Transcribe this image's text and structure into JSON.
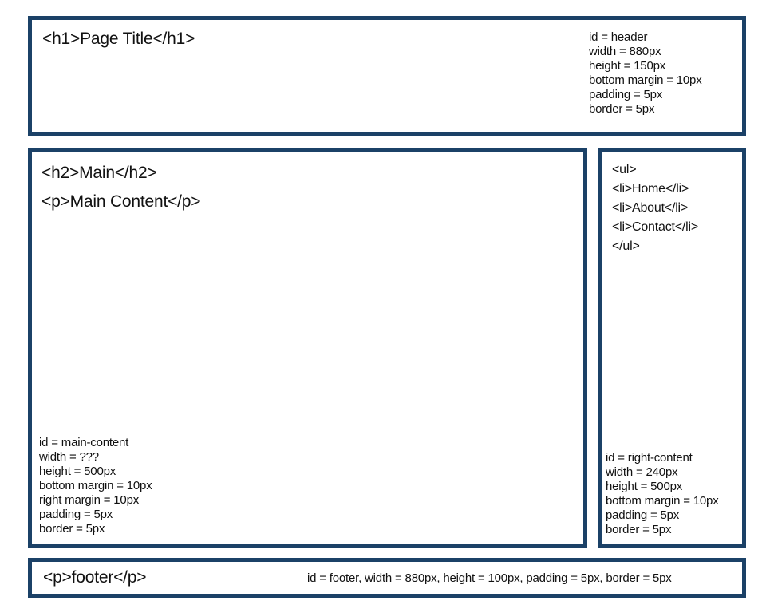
{
  "header": {
    "tag_text": "<h1>Page Title</h1>",
    "specs": [
      "id = header",
      "width = 880px",
      "height = 150px",
      "bottom margin = 10px",
      "padding = 5px",
      "border = 5px"
    ]
  },
  "main": {
    "heading_text": "<h2>Main</h2>",
    "paragraph_text": "<p>Main Content</p>",
    "specs": [
      "id = main-content",
      "width = ???",
      "height = 500px",
      "bottom margin = 10px",
      "right margin = 10px",
      "padding = 5px",
      "border = 5px"
    ]
  },
  "right": {
    "list_lines": [
      "<ul>",
      "<li>Home</li>",
      "<li>About</li>",
      "<li>Contact</li>",
      "</ul>"
    ],
    "specs": [
      "id = right-content",
      "width = 240px",
      "height = 500px",
      "bottom margin = 10px",
      "padding = 5px",
      "border = 5px"
    ]
  },
  "footer": {
    "tag_text": "<p>footer</p>",
    "spec_text": "id = footer, width = 880px, height = 100px, padding = 5px, border = 5px"
  },
  "colors": {
    "border": "#1b4167",
    "text": "#111111",
    "background": "#ffffff"
  }
}
